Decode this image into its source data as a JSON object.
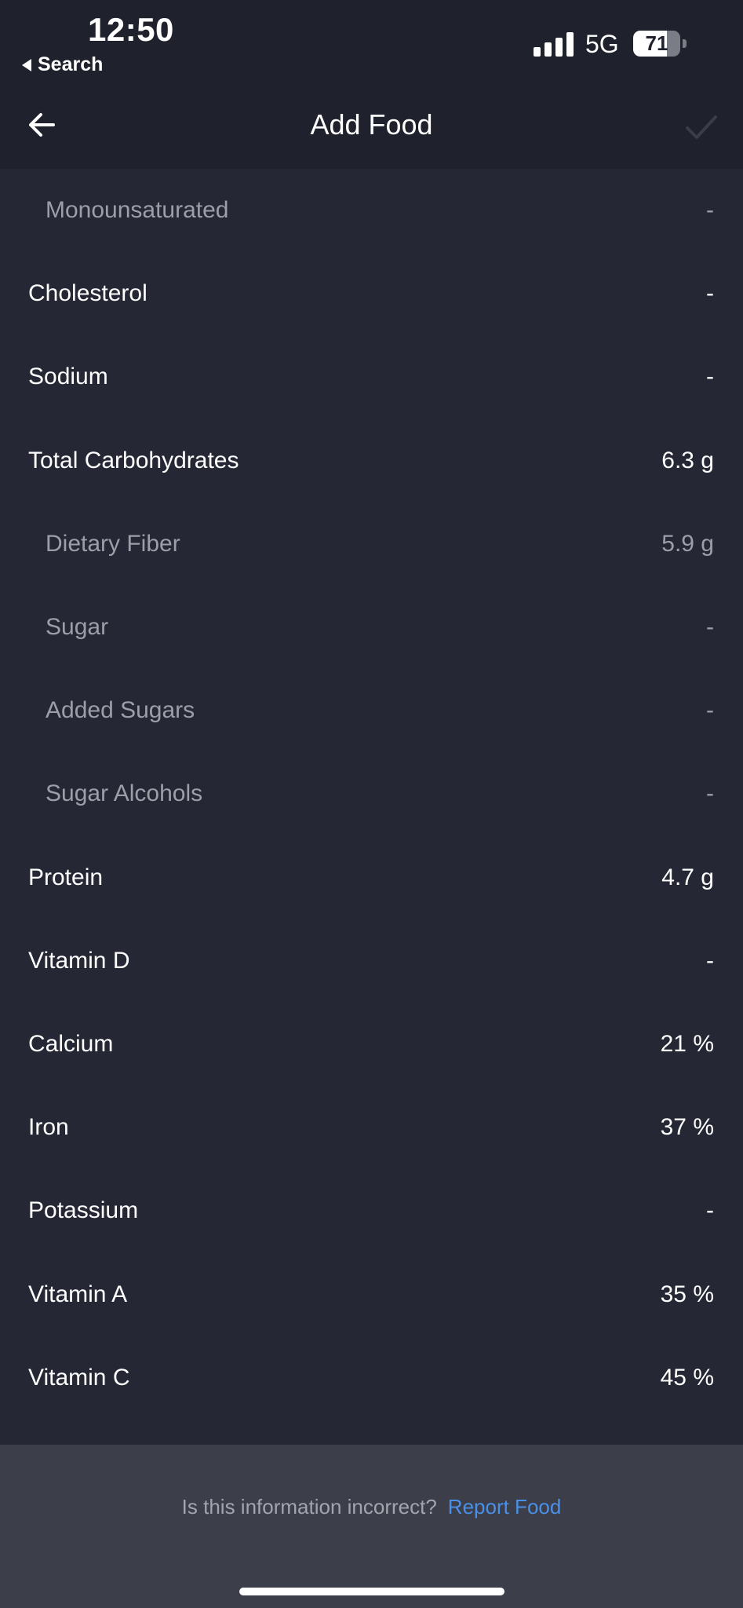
{
  "status_bar": {
    "time": "12:50",
    "back_app": "Search",
    "network": "5G",
    "battery": "71",
    "battery_level": 0.71
  },
  "nav": {
    "title": "Add Food",
    "back_icon": "arrow-left-icon",
    "confirm_icon": "checkmark-icon"
  },
  "nutrients": [
    {
      "label": "Monounsaturated",
      "value": "-",
      "sub": true
    },
    {
      "label": "Cholesterol",
      "value": "-",
      "sub": false
    },
    {
      "label": "Sodium",
      "value": "-",
      "sub": false
    },
    {
      "label": "Total Carbohydrates",
      "value": "6.3 g",
      "sub": false
    },
    {
      "label": "Dietary Fiber",
      "value": "5.9 g",
      "sub": true
    },
    {
      "label": "Sugar",
      "value": "-",
      "sub": true
    },
    {
      "label": "Added Sugars",
      "value": "-",
      "sub": true
    },
    {
      "label": "Sugar Alcohols",
      "value": "-",
      "sub": true
    },
    {
      "label": "Protein",
      "value": "4.7 g",
      "sub": false
    },
    {
      "label": "Vitamin D",
      "value": "-",
      "sub": false
    },
    {
      "label": "Calcium",
      "value": "21 %",
      "sub": false
    },
    {
      "label": "Iron",
      "value": "37 %",
      "sub": false
    },
    {
      "label": "Potassium",
      "value": "-",
      "sub": false
    },
    {
      "label": "Vitamin A",
      "value": "35 %",
      "sub": false
    },
    {
      "label": "Vitamin C",
      "value": "45 %",
      "sub": false
    }
  ],
  "footer": {
    "question": "Is this information incorrect?",
    "link": "Report Food"
  },
  "colors": {
    "background": "#252734",
    "header": "#1f212c",
    "footer": "#3c3e49",
    "link": "#4a90e8",
    "muted_text": "#9d9fa8"
  }
}
